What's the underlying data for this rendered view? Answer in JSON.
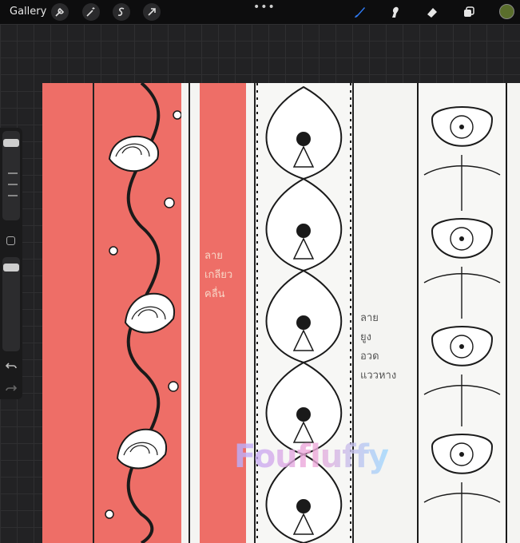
{
  "toolbar": {
    "gallery_label": "Gallery",
    "left_tools": [
      "wrench-icon",
      "magic-wand-icon",
      "selection-icon",
      "transform-arrow-icon"
    ],
    "more_label": "•••",
    "right_tools": [
      "brush-icon",
      "smudge-icon",
      "eraser-icon",
      "layers-icon"
    ],
    "active_tool": "brush-icon",
    "current_color": "#5a6e2c",
    "accent": "#2f7cf6"
  },
  "sidebar": {
    "brush_size_level": 0.9,
    "opacity_level": 0.85
  },
  "canvas": {
    "handwriting_left": [
      "ลาย",
      "เกลียว",
      "คลื่น"
    ],
    "handwriting_right": [
      "ลาย",
      "ยูง",
      "อวด",
      "แววหาง"
    ],
    "watermark": "Foufluffy",
    "highlight_color": "#ee6e67"
  }
}
